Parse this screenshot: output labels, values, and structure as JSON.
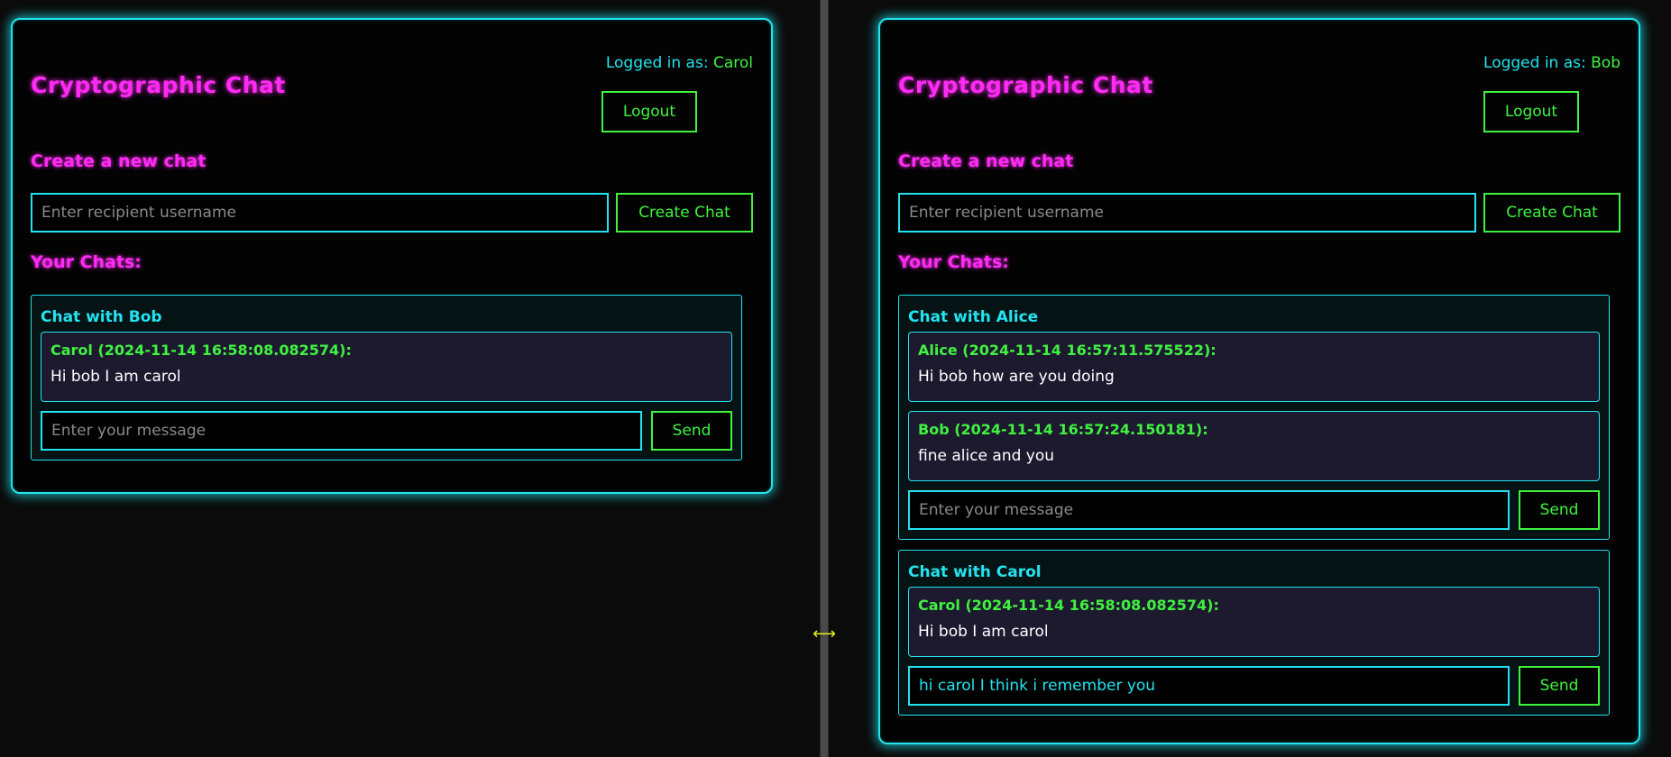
{
  "panes": [
    {
      "app_title": "Cryptographic Chat",
      "logged_prefix": "Logged in as: ",
      "logged_user": "Carol",
      "logout_label": "Logout",
      "create_heading": "Create a new chat",
      "recipient_placeholder": "Enter recipient username",
      "create_label": "Create Chat",
      "chats_heading": "Your Chats:",
      "chats": [
        {
          "title": "Chat with Bob",
          "messages": [
            {
              "meta": "Carol (2024-11-14 16:58:08.082574):",
              "text": "Hi bob I am carol"
            }
          ],
          "input_placeholder": "Enter your message",
          "input_value": "",
          "send_label": "Send"
        }
      ]
    },
    {
      "app_title": "Cryptographic Chat",
      "logged_prefix": "Logged in as: ",
      "logged_user": "Bob",
      "logout_label": "Logout",
      "create_heading": "Create a new chat",
      "recipient_placeholder": "Enter recipient username",
      "create_label": "Create Chat",
      "chats_heading": "Your Chats:",
      "chats": [
        {
          "title": "Chat with Alice",
          "messages": [
            {
              "meta": "Alice (2024-11-14 16:57:11.575522):",
              "text": "Hi bob how are you doing"
            },
            {
              "meta": "Bob (2024-11-14 16:57:24.150181):",
              "text": "fine alice and you"
            }
          ],
          "input_placeholder": "Enter your message",
          "input_value": "",
          "send_label": "Send"
        },
        {
          "title": "Chat with Carol",
          "messages": [
            {
              "meta": "Carol (2024-11-14 16:58:08.082574):",
              "text": "Hi bob I am carol"
            }
          ],
          "input_placeholder": "Enter your message",
          "input_value": "hi carol I think i remember you",
          "send_label": "Send"
        }
      ]
    }
  ],
  "splitter_icon": "resize-horizontal-icon",
  "splitter_glyph": "⟷",
  "colors": {
    "accent_cyan": "#22e4ef",
    "accent_magenta": "#ff2bf4",
    "accent_green": "#3ff23f",
    "background": "#030303",
    "message_bg": "#1d1a30"
  }
}
